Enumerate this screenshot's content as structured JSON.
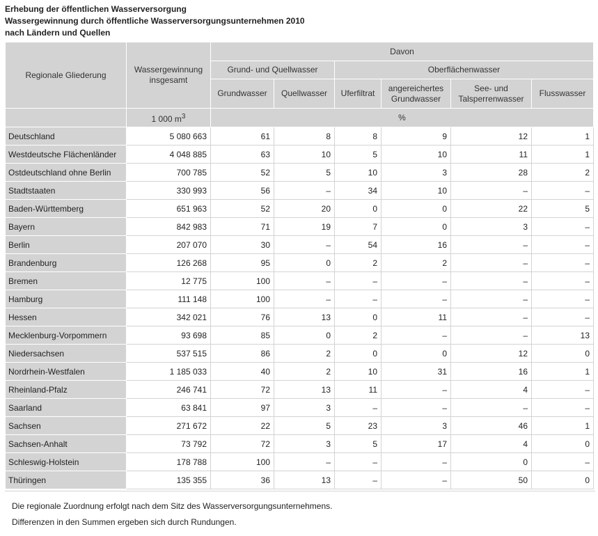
{
  "title": {
    "line1": "Erhebung der öffentlichen Wasserversorgung",
    "line2": "Wassergewinnung durch öffentliche Wasserversorgungsunternehmen 2010",
    "line3": "nach Ländern und Quellen"
  },
  "header": {
    "regional": "Regionale Gliederung",
    "total": "Wassergewinnung insgesamt",
    "davon": "Davon",
    "grund_group": "Grund- und Quellwasser",
    "ober_group": "Oberflächenwasser",
    "cols": [
      "Grundwasser",
      "Quellwasser",
      "Uferfiltrat",
      "angereichertes Grundwasser",
      "See- und Talsperrenwasser",
      "Flusswasser"
    ],
    "unit_total": "1 000 m",
    "unit_total_sup": "3",
    "unit_pct": "%"
  },
  "rows": [
    [
      "Deutschland",
      "5 080 663",
      "61",
      "8",
      "8",
      "9",
      "12",
      "1"
    ],
    [
      "Westdeutsche Flächenländer",
      "4 048 885",
      "63",
      "10",
      "5",
      "10",
      "11",
      "1"
    ],
    [
      "Ostdeutschland ohne Berlin",
      "700 785",
      "52",
      "5",
      "10",
      "3",
      "28",
      "2"
    ],
    [
      "Stadtstaaten",
      "330 993",
      "56",
      "–",
      "34",
      "10",
      "–",
      "–"
    ],
    [
      "Baden-Württemberg",
      "651 963",
      "52",
      "20",
      "0",
      "0",
      "22",
      "5"
    ],
    [
      "Bayern",
      "842 983",
      "71",
      "19",
      "7",
      "0",
      "3",
      "–"
    ],
    [
      "Berlin",
      "207 070",
      "30",
      "–",
      "54",
      "16",
      "–",
      "–"
    ],
    [
      "Brandenburg",
      "126 268",
      "95",
      "0",
      "2",
      "2",
      "–",
      "–"
    ],
    [
      "Bremen",
      "12 775",
      "100",
      "–",
      "–",
      "–",
      "–",
      "–"
    ],
    [
      "Hamburg",
      "111 148",
      "100",
      "–",
      "–",
      "–",
      "–",
      "–"
    ],
    [
      "Hessen",
      "342 021",
      "76",
      "13",
      "0",
      "11",
      "–",
      "–"
    ],
    [
      "Mecklenburg-Vorpommern",
      "93 698",
      "85",
      "0",
      "2",
      "–",
      "–",
      "13"
    ],
    [
      "Niedersachsen",
      "537 515",
      "86",
      "2",
      "0",
      "0",
      "12",
      "0"
    ],
    [
      "Nordrhein-Westfalen",
      "1 185 033",
      "40",
      "2",
      "10",
      "31",
      "16",
      "1"
    ],
    [
      "Rheinland-Pfalz",
      "246 741",
      "72",
      "13",
      "11",
      "–",
      "4",
      "–"
    ],
    [
      "Saarland",
      "63 841",
      "97",
      "3",
      "–",
      "–",
      "–",
      "–"
    ],
    [
      "Sachsen",
      "271 672",
      "22",
      "5",
      "23",
      "3",
      "46",
      "1"
    ],
    [
      "Sachsen-Anhalt",
      "73 792",
      "72",
      "3",
      "5",
      "17",
      "4",
      "0"
    ],
    [
      "Schleswig-Holstein",
      "178 788",
      "100",
      "–",
      "–",
      "–",
      "0",
      "–"
    ],
    [
      "Thüringen",
      "135 355",
      "36",
      "13",
      "–",
      "–",
      "50",
      "0"
    ]
  ],
  "notes": [
    "Die regionale Zuordnung erfolgt nach dem Sitz des Wasserversorgungsunternehmens.",
    "Differenzen in den Summen ergeben sich durch Rundungen."
  ]
}
